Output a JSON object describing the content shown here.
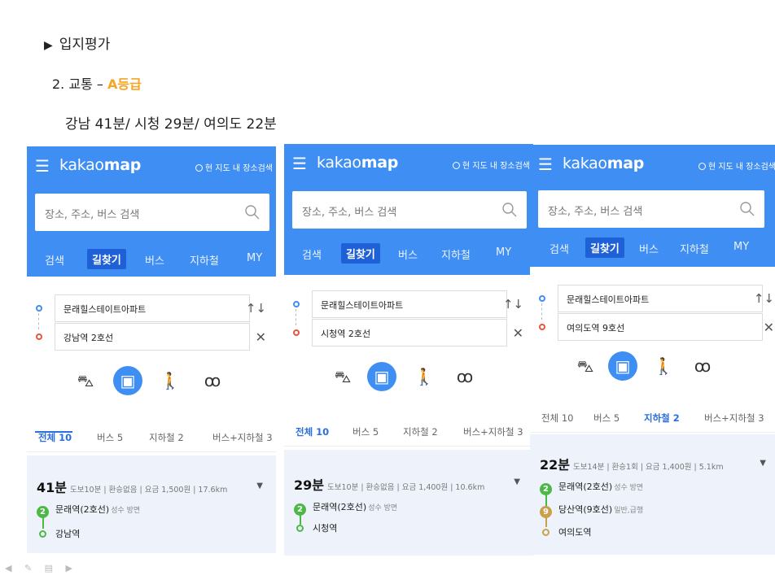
{
  "slide": {
    "heading_marker": "▶",
    "heading": "입지평가",
    "section_prefix": "2. 교통 – ",
    "section_grade": "A등급",
    "times": "강남 41분/ 시청 29분/ 여의도 22분"
  },
  "common": {
    "menu_icon": "hamburger-icon",
    "brand_regular": "kakao",
    "brand_bold": "map",
    "here_search": "현 지도 내 장소검색",
    "search_placeholder": "장소, 주소, 버스 검색",
    "nav_tabs": [
      "검색",
      "길찾기",
      "버스",
      "지하철",
      "MY"
    ],
    "active_nav": "길찾기",
    "origin": "문래힐스테이트아파트",
    "modes": [
      "car-icon",
      "bus-icon",
      "walk-icon",
      "bike-icon"
    ],
    "active_mode": "bus-icon",
    "swap_icon": "↑↓",
    "clear_icon": "✕",
    "dropdown_icon": "▼"
  },
  "panels": [
    {
      "destination": "강남역 2호선",
      "filters": [
        "전체 10",
        "버스 5",
        "지하철 2",
        "버스+지하철 3"
      ],
      "active_filter": "전체 10",
      "duration": "41분",
      "meta": "도보10분 | 환승없음 | 요금 1,500원 | 17.6km",
      "stops": [
        {
          "line": "2",
          "line_color": "#4db848",
          "name": "문래역(2호선)",
          "note": "성수 방면"
        },
        {
          "line": "",
          "line_color": "#4db848",
          "name": "강남역",
          "note": ""
        }
      ]
    },
    {
      "destination": "시청역 2호선",
      "filters": [
        "전체 10",
        "버스 5",
        "지하철 2",
        "버스+지하철 3"
      ],
      "active_filter": "전체 10",
      "duration": "29분",
      "meta": "도보10분 | 환승없음 | 요금 1,400원 | 10.6km",
      "stops": [
        {
          "line": "2",
          "line_color": "#4db848",
          "name": "문래역(2호선)",
          "note": "성수 방면"
        },
        {
          "line": "",
          "line_color": "#4db848",
          "name": "시청역",
          "note": ""
        }
      ]
    },
    {
      "destination": "여의도역 9호선",
      "filters": [
        "전체 10",
        "버스 5",
        "지하철 2",
        "버스+지하철 3"
      ],
      "active_filter": "지하철 2",
      "duration": "22분",
      "meta": "도보14분 | 환승1회 | 요금 1,400원 | 5.1km",
      "stops": [
        {
          "line": "2",
          "line_color": "#4db848",
          "name": "문래역(2호선)",
          "note": "성수 방면"
        },
        {
          "line": "9",
          "line_color": "#c8a14a",
          "name": "당산역(9호선)",
          "note": "일반,급행"
        },
        {
          "line": "",
          "line_color": "#c8a14a",
          "name": "여의도역",
          "note": ""
        }
      ]
    }
  ],
  "footer_icons": "◀ ✎ ▤ ▶"
}
